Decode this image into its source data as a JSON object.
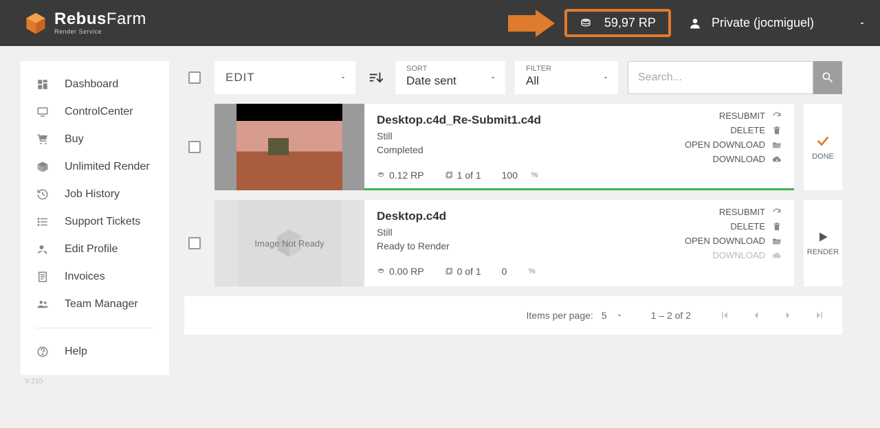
{
  "header": {
    "brand_main_a": "Rebus",
    "brand_main_b": "Farm",
    "brand_sub": "Render Service",
    "balance": "59,97 RP",
    "user_label": "Private (jocmiguel)"
  },
  "sidebar": {
    "items": [
      {
        "label": "Dashboard"
      },
      {
        "label": "ControlCenter"
      },
      {
        "label": "Buy"
      },
      {
        "label": "Unlimited Render"
      },
      {
        "label": "Job History"
      },
      {
        "label": "Support Tickets"
      },
      {
        "label": "Edit Profile"
      },
      {
        "label": "Invoices"
      },
      {
        "label": "Team Manager"
      }
    ],
    "help_label": "Help",
    "version": "V 210"
  },
  "toolbar": {
    "edit_label": "EDIT",
    "sort_caption": "SORT",
    "sort_value": "Date sent",
    "filter_caption": "FILTER",
    "filter_value": "All",
    "search_placeholder": "Search..."
  },
  "jobs": [
    {
      "title": "Desktop.c4d_Re-Submit1.c4d",
      "type": "Still",
      "status": "Completed",
      "cost": "0.12 RP",
      "frames": "1 of 1",
      "percent": "100",
      "thumb": "image",
      "actions": {
        "resubmit": "RESUBMIT",
        "delete": "DELETE",
        "open": "OPEN DOWNLOAD",
        "download": "DOWNLOAD"
      },
      "download_enabled": true,
      "side": {
        "label": "DONE",
        "kind": "done"
      }
    },
    {
      "title": "Desktop.c4d",
      "type": "Still",
      "status": "Ready to Render",
      "cost": "0.00 RP",
      "frames": "0 of 1",
      "percent": "0",
      "thumb": "Image Not Ready",
      "actions": {
        "resubmit": "RESUBMIT",
        "delete": "DELETE",
        "open": "OPEN DOWNLOAD",
        "download": "DOWNLOAD"
      },
      "download_enabled": false,
      "side": {
        "label": "RENDER",
        "kind": "render"
      }
    }
  ],
  "pager": {
    "perpage_label": "Items per page:",
    "perpage_value": "5",
    "range": "1 – 2 of 2"
  },
  "percent_symbol": "%"
}
